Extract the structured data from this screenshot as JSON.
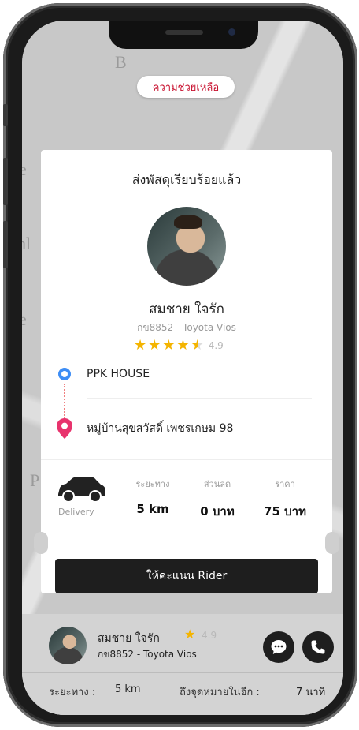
{
  "help": {
    "label": "ความช่วยเหลือ"
  },
  "card": {
    "title": "ส่งพัสดุเรียบร้อยแล้ว",
    "driver": {
      "name": "สมชาย ใจรัก",
      "plate_vehicle": "กข8852 - Toyota Vios",
      "rating": "4.9",
      "stars": 4.5
    },
    "route": {
      "origin": "PPK HOUSE",
      "destination": "หมู่บ้านสุขสวัสดิ์ เพชรเกษม 98"
    },
    "vehicle_type": "Delivery",
    "stats": [
      {
        "label": "ระยะทาง",
        "value": "5 km"
      },
      {
        "label": "ส่วนลด",
        "value": "0 บาท"
      },
      {
        "label": "ราคา",
        "value": "75 บาท"
      }
    ],
    "rate_button": "ให้คะแนน Rider"
  },
  "bottom": {
    "name": "สมชาย ใจรัก",
    "rating": "4.9",
    "plate_vehicle": "กข8852 - Toyota Vios",
    "distance_label": "ระยะทาง :",
    "distance_value": "5 km",
    "eta_label": "ถึงจุดหมายในอีก :",
    "eta_value": "7 นาที"
  },
  "colors": {
    "accent_red": "#c8102e",
    "star": "#f4b400",
    "origin_pin": "#3d8df5",
    "destination_pin": "#e8336d",
    "button_dark": "#1e1e1e"
  },
  "icons": [
    "location-origin-icon",
    "location-pin-icon",
    "car-icon",
    "star-icon",
    "chat-icon",
    "phone-icon"
  ]
}
